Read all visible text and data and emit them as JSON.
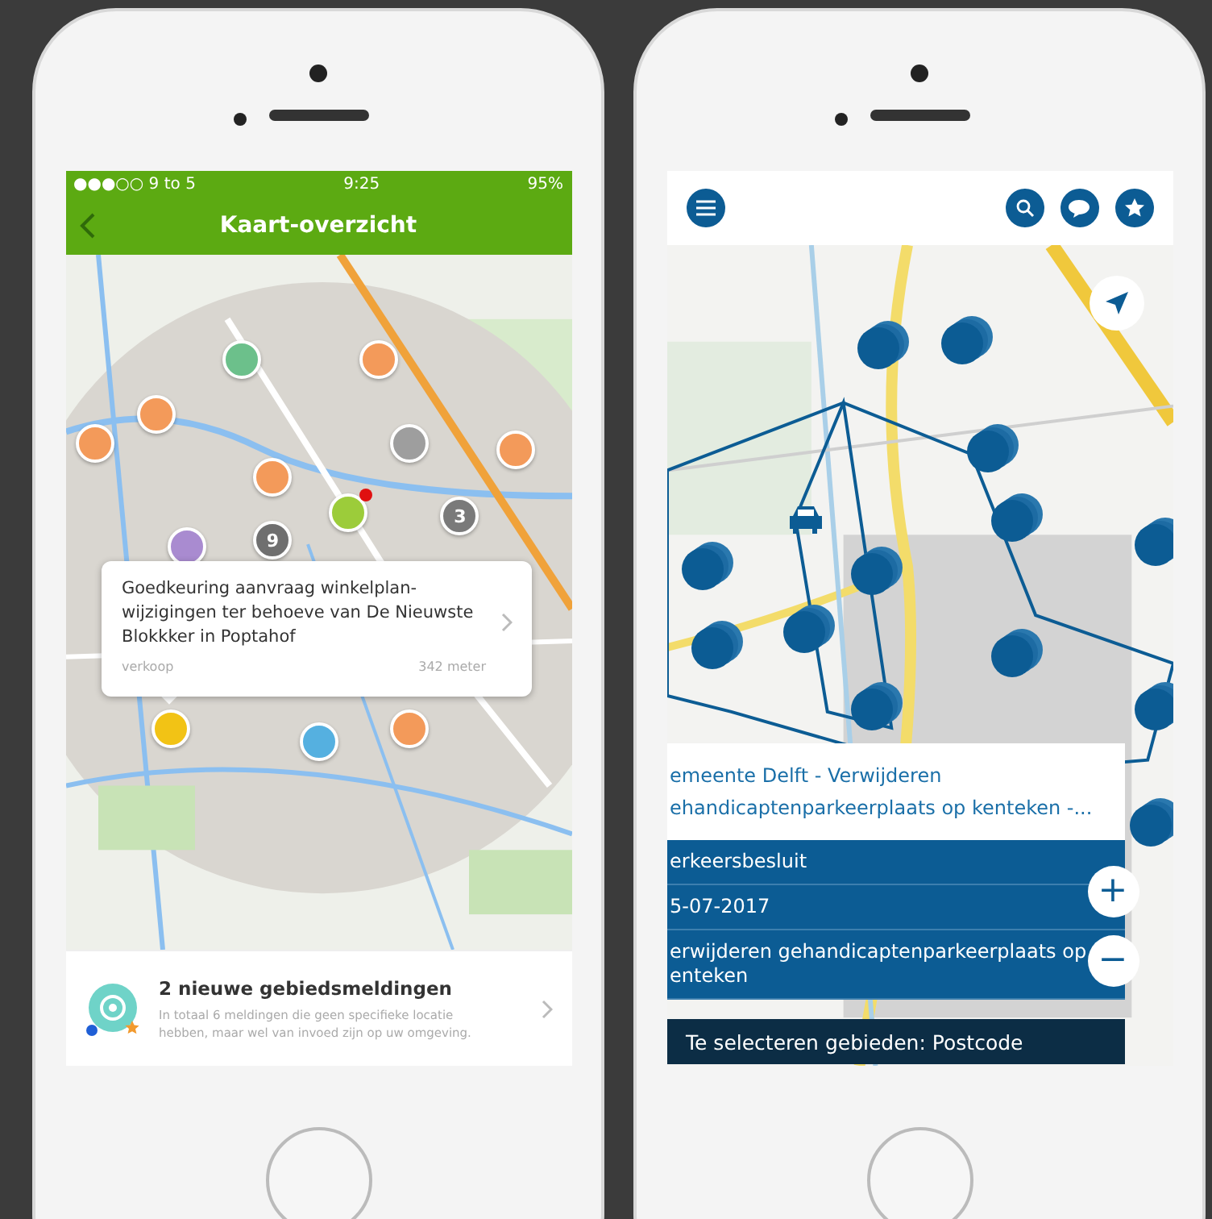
{
  "left_phone": {
    "status_bar": {
      "carrier": "●●●○○ 9 to 5",
      "time": "9:25",
      "battery": "95%"
    },
    "nav_bar": {
      "title": "Kaart-overzicht"
    },
    "map": {
      "markers": [
        {
          "color": "#6cc08b"
        },
        {
          "color": "#f39a5a"
        },
        {
          "color": "#f39a5a"
        },
        {
          "color": "#f39a5a"
        },
        {
          "color": "#9e9e9e"
        },
        {
          "color": "#f39a5a"
        },
        {
          "color": "#f39a5a"
        },
        {
          "color": "#9ccc3a",
          "alert": true
        },
        {
          "color": "#7a7a7a",
          "label": "3"
        },
        {
          "color": "#6f6f6f",
          "label": "9"
        },
        {
          "color": "#a98bd0"
        },
        {
          "color": "#f2c315"
        },
        {
          "color": "#55b0e0"
        },
        {
          "color": "#f39a5a"
        }
      ],
      "popup": {
        "title": "Goedkeuring aanvraag winkelplan-wijzigingen ter behoeve van De Nieuwste Blokkker in Poptahof",
        "category": "verkoop",
        "distance": "342 meter"
      }
    },
    "notice": {
      "title": "2 nieuwe gebiedsmeldingen",
      "text": "In totaal 6 meldingen die geen specifieke locatie hebben, maar wel van invoed zijn op uw omgeving."
    }
  },
  "right_phone": {
    "toolbar": {
      "buttons": [
        {
          "kind": "menu"
        },
        {
          "kind": "search"
        },
        {
          "kind": "chat"
        },
        {
          "kind": "star"
        }
      ]
    },
    "detail": {
      "title_lines": [
        "emeente Delft - Verwijderen",
        "ehandicaptenparkeerplaats op kenteken -..."
      ],
      "rows": [
        "erkeersbesluit",
        "5-07-2017",
        "erwijderen gehandicaptenparkeerplaats op enteken"
      ],
      "footer": "Te selecteren gebieden: Postcode"
    },
    "zoom": [
      "+",
      "−"
    ]
  }
}
